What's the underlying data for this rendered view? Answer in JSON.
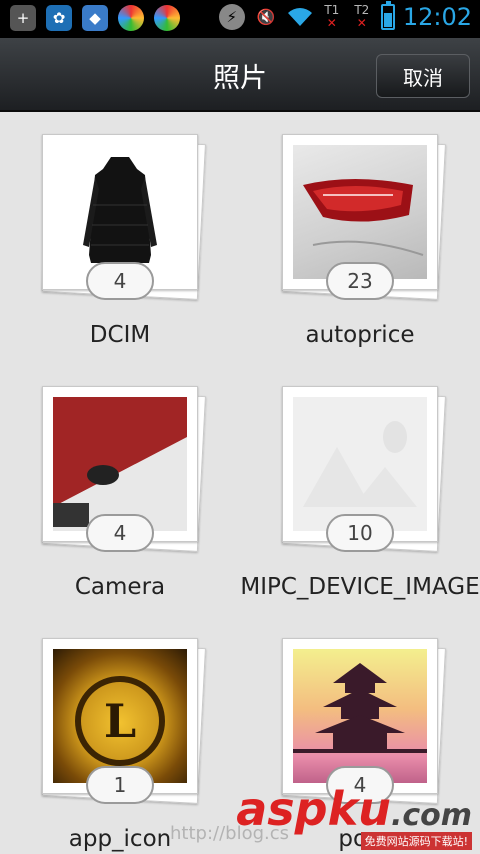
{
  "status_bar": {
    "left_icons": [
      "add-icon",
      "butterfly-icon",
      "shield-icon",
      "color-wheel-icon",
      "color-wheel-icon"
    ],
    "sim1": "T1",
    "sim2": "T2",
    "time": "12:02"
  },
  "header": {
    "title": "照片",
    "cancel_label": "取消"
  },
  "albums": [
    {
      "name": "DCIM",
      "count": "4",
      "thumb": "coat"
    },
    {
      "name": "autoprice",
      "count": "23",
      "thumb": "car-taillight"
    },
    {
      "name": "Camera",
      "count": "4",
      "thumb": "desk-mouse"
    },
    {
      "name": "MIPC_DEVICE_IMAGE",
      "count": "10",
      "thumb": "image-placeholder"
    },
    {
      "name": "app_icon",
      "count": "1",
      "thumb": "gold-emblem"
    },
    {
      "name": "pon",
      "count": "4",
      "thumb": "pagoda"
    }
  ],
  "watermark": {
    "brand": "aspku",
    "tld": ".com",
    "tagline": "免费网站源码下载站!",
    "url_fragment": "http://blog.cs"
  },
  "colors": {
    "accent": "#2aa7e6",
    "titlebar": "#2b2e31",
    "background": "#e4e4e4"
  }
}
